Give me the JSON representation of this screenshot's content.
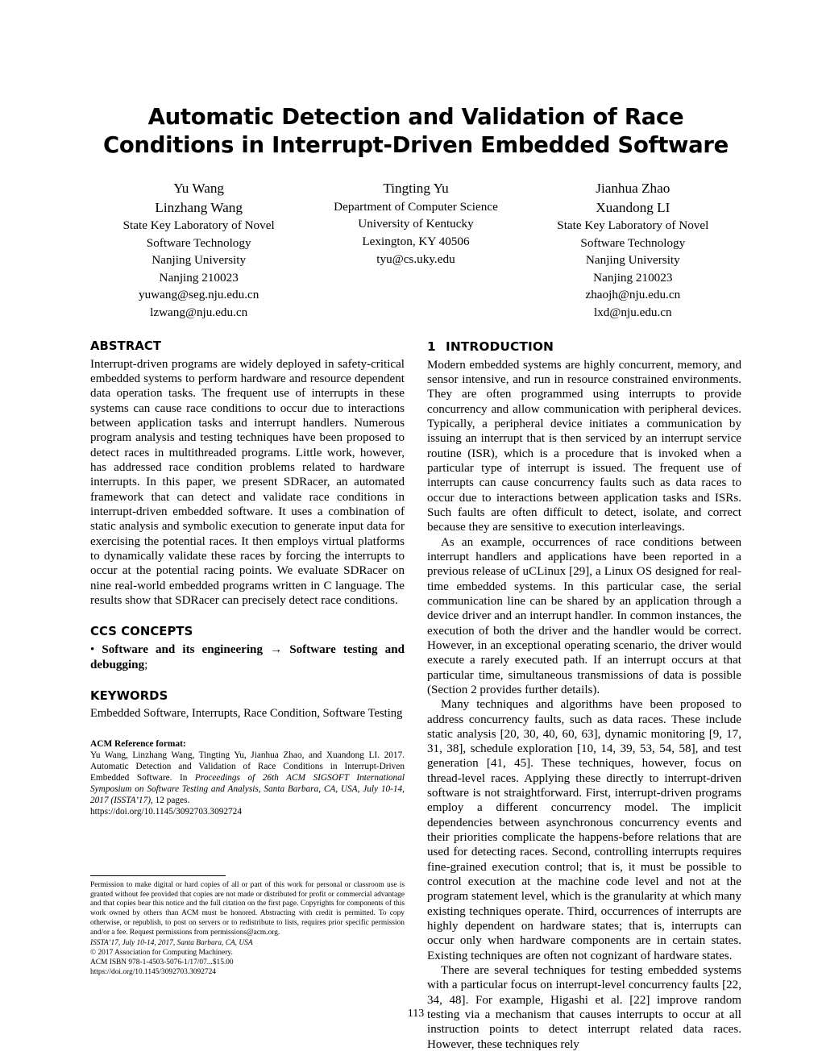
{
  "paper": {
    "title": "Automatic Detection and Validation of Race Conditions in Interrupt-Driven Embedded Software",
    "page_number": "113"
  },
  "authors": [
    {
      "name_line_1": "Yu Wang",
      "name_line_2": "Linzhang Wang",
      "affil_1": "State Key Laboratory of Novel",
      "affil_2": "Software Technology",
      "affil_3": "Nanjing University",
      "affil_4": "Nanjing 210023",
      "email_1": "yuwang@seg.nju.edu.cn",
      "email_2": "lzwang@nju.edu.cn"
    },
    {
      "name_line_1": "Tingting Yu",
      "affil_1": "Department of Computer Science",
      "affil_2": "University of Kentucky",
      "affil_3": "Lexington, KY 40506",
      "email_1": "tyu@cs.uky.edu"
    },
    {
      "name_line_1": "Jianhua Zhao",
      "name_line_2": "Xuandong LI",
      "affil_1": "State Key Laboratory of Novel",
      "affil_2": "Software Technology",
      "affil_3": "Nanjing University",
      "affil_4": "Nanjing 210023",
      "email_1": "zhaojh@nju.edu.cn",
      "email_2": "lxd@nju.edu.cn"
    }
  ],
  "left_column": {
    "abstract_heading": "ABSTRACT",
    "abstract_text": "Interrupt-driven programs are widely deployed in safety-critical embedded systems to perform hardware and resource dependent data operation tasks. The frequent use of interrupts in these systems can cause race conditions to occur due to interactions between application tasks and interrupt handlers. Numerous program analysis and testing techniques have been proposed to detect races in multithreaded programs. Little work, however, has addressed race condition problems related to hardware interrupts. In this paper, we present SDRacer, an automated framework that can detect and validate race conditions in interrupt-driven embedded software. It uses a combination of static analysis and symbolic execution to generate input data for exercising the potential races. It then employs virtual platforms to dynamically validate these races by forcing the interrupts to occur at the potential racing points. We evaluate SDRacer on nine real-world embedded programs written in C language. The results show that SDRacer can precisely detect race conditions.",
    "ccs_heading": "CCS CONCEPTS",
    "ccs_bullet": "•",
    "ccs_bold_1": "Software and its engineering",
    "ccs_arrow": "→",
    "ccs_bold_2": "Software testing and debugging",
    "ccs_tail": ";",
    "keywords_heading": "KEYWORDS",
    "keywords_text": "Embedded Software, Interrupts, Race Condition, Software Testing",
    "acm_ref_heading": "ACM Reference format:",
    "acm_ref_part_1": "Yu Wang, Linzhang Wang, Tingting Yu, Jianhua Zhao, and Xuandong LI. 2017. Automatic Detection and Validation of Race Conditions in Interrupt-Driven Embedded Software. In ",
    "acm_ref_italic": "Proceedings of 26th ACM SIGSOFT International Symposium on Software Testing and Analysis, Santa Barbara, CA, USA, July 10-14, 2017 (ISSTA’17),",
    "acm_ref_part_2": " 12 pages.",
    "acm_ref_doi": "https://doi.org/10.1145/3092703.3092724"
  },
  "footnote": {
    "permission_text": "Permission to make digital or hard copies of all or part of this work for personal or classroom use is granted without fee provided that copies are not made or distributed for profit or commercial advantage and that copies bear this notice and the full citation on the first page. Copyrights for components of this work owned by others than ACM must be honored. Abstracting with credit is permitted. To copy otherwise, or republish, to post on servers or to redistribute to lists, requires prior specific permission and/or a fee. Request permissions from permissions@acm.org.",
    "conference": "ISSTA’17, July 10-14, 2017, Santa Barbara, CA, USA",
    "copyright": "© 2017 Association for Computing Machinery.",
    "isbn": "ACM ISBN 978-1-4503-5076-1/17/07...$15.00",
    "doi": "https://doi.org/10.1145/3092703.3092724"
  },
  "right_column": {
    "section_number": "1",
    "section_heading": "INTRODUCTION",
    "paragraph_1": "Modern embedded systems are highly concurrent, memory, and sensor intensive, and run in resource constrained environments. They are often programmed using interrupts to provide concurrency and allow communication with peripheral devices. Typically, a peripheral device initiates a communication by issuing an interrupt that is then serviced by an interrupt service routine (ISR), which is a procedure that is invoked when a particular type of interrupt is issued. The frequent use of interrupts can cause concurrency faults such as data races to occur due to interactions between application tasks and ISRs. Such faults are often difficult to detect, isolate, and correct because they are sensitive to execution interleavings.",
    "paragraph_2": "As an example, occurrences of race conditions between interrupt handlers and applications have been reported in a previous release of uCLinux [29], a Linux OS designed for real-time embedded systems. In this particular case, the serial communication line can be shared by an application through a device driver and an interrupt handler. In common instances, the execution of both the driver and the handler would be correct. However, in an exceptional operating scenario, the driver would execute a rarely executed path. If an interrupt occurs at that particular time, simultaneous transmissions of data is possible (Section 2 provides further details).",
    "paragraph_3": "Many techniques and algorithms have been proposed to address concurrency faults, such as data races. These include static analysis [20, 30, 40, 60, 63], dynamic monitoring [9, 17, 31, 38], schedule exploration [10, 14, 39, 53, 54, 58], and test generation [41, 45]. These techniques, however, focus on thread-level races. Applying these directly to interrupt-driven software is not straightforward. First, interrupt-driven programs employ a different concurrency model. The implicit dependencies between asynchronous concurrency events and their priorities complicate the happens-before relations that are used for detecting races. Second, controlling interrupts requires fine-grained execution control; that is, it must be possible to control execution at the machine code level and not at the program statement level, which is the granularity at which many existing techniques operate. Third, occurrences of interrupts are highly dependent on hardware states; that is, interrupts can occur only when hardware components are in certain states. Existing techniques are often not cognizant of hardware states.",
    "paragraph_4": "There are several techniques for testing embedded systems with a particular focus on interrupt-level concurrency faults [22, 34, 48]. For example, Higashi et al. [22] improve random testing via a mechanism that causes interrupts to occur at all instruction points to detect interrupt related data races. However, these techniques rely"
  }
}
